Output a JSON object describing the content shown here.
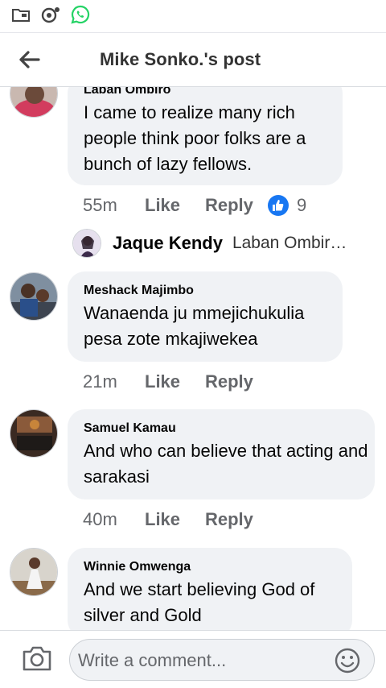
{
  "status_bar": {
    "icons": [
      "folder-icon",
      "game-icon",
      "whatsapp-icon"
    ]
  },
  "header": {
    "back_icon": "back-arrow-icon",
    "title": "Mike Sonko.'s post"
  },
  "comments": [
    {
      "author": "Laban Ombiro",
      "text": "I came to realize many rich people think poor folks are a bunch of lazy fellows.",
      "time": "55m",
      "like_label": "Like",
      "reply_label": "Reply",
      "reaction_icon": "like-reaction-icon",
      "reaction_count": "9",
      "reply_preview": {
        "author": "Jaque Kendy",
        "snippet": "Laban Ombir…"
      }
    },
    {
      "author": "Meshack Majimbo",
      "text": "Wanaenda ju mmejichukulia pesa zote mkajiwekea",
      "time": "21m",
      "like_label": "Like",
      "reply_label": "Reply"
    },
    {
      "author": "Samuel Kamau",
      "text": "And who can believe that acting and sarakasi",
      "time": "40m",
      "like_label": "Like",
      "reply_label": "Reply"
    },
    {
      "author": "Winnie Omwenga",
      "text": "And we start believing God of silver and Gold"
    }
  ],
  "composer": {
    "camera_icon": "camera-icon",
    "placeholder": "Write a comment...",
    "emoji_icon": "emoji-icon"
  },
  "colors": {
    "accent": "#1877f2",
    "bubble": "#f0f2f5",
    "secondary_text": "#65676b",
    "whatsapp": "#25d366"
  }
}
